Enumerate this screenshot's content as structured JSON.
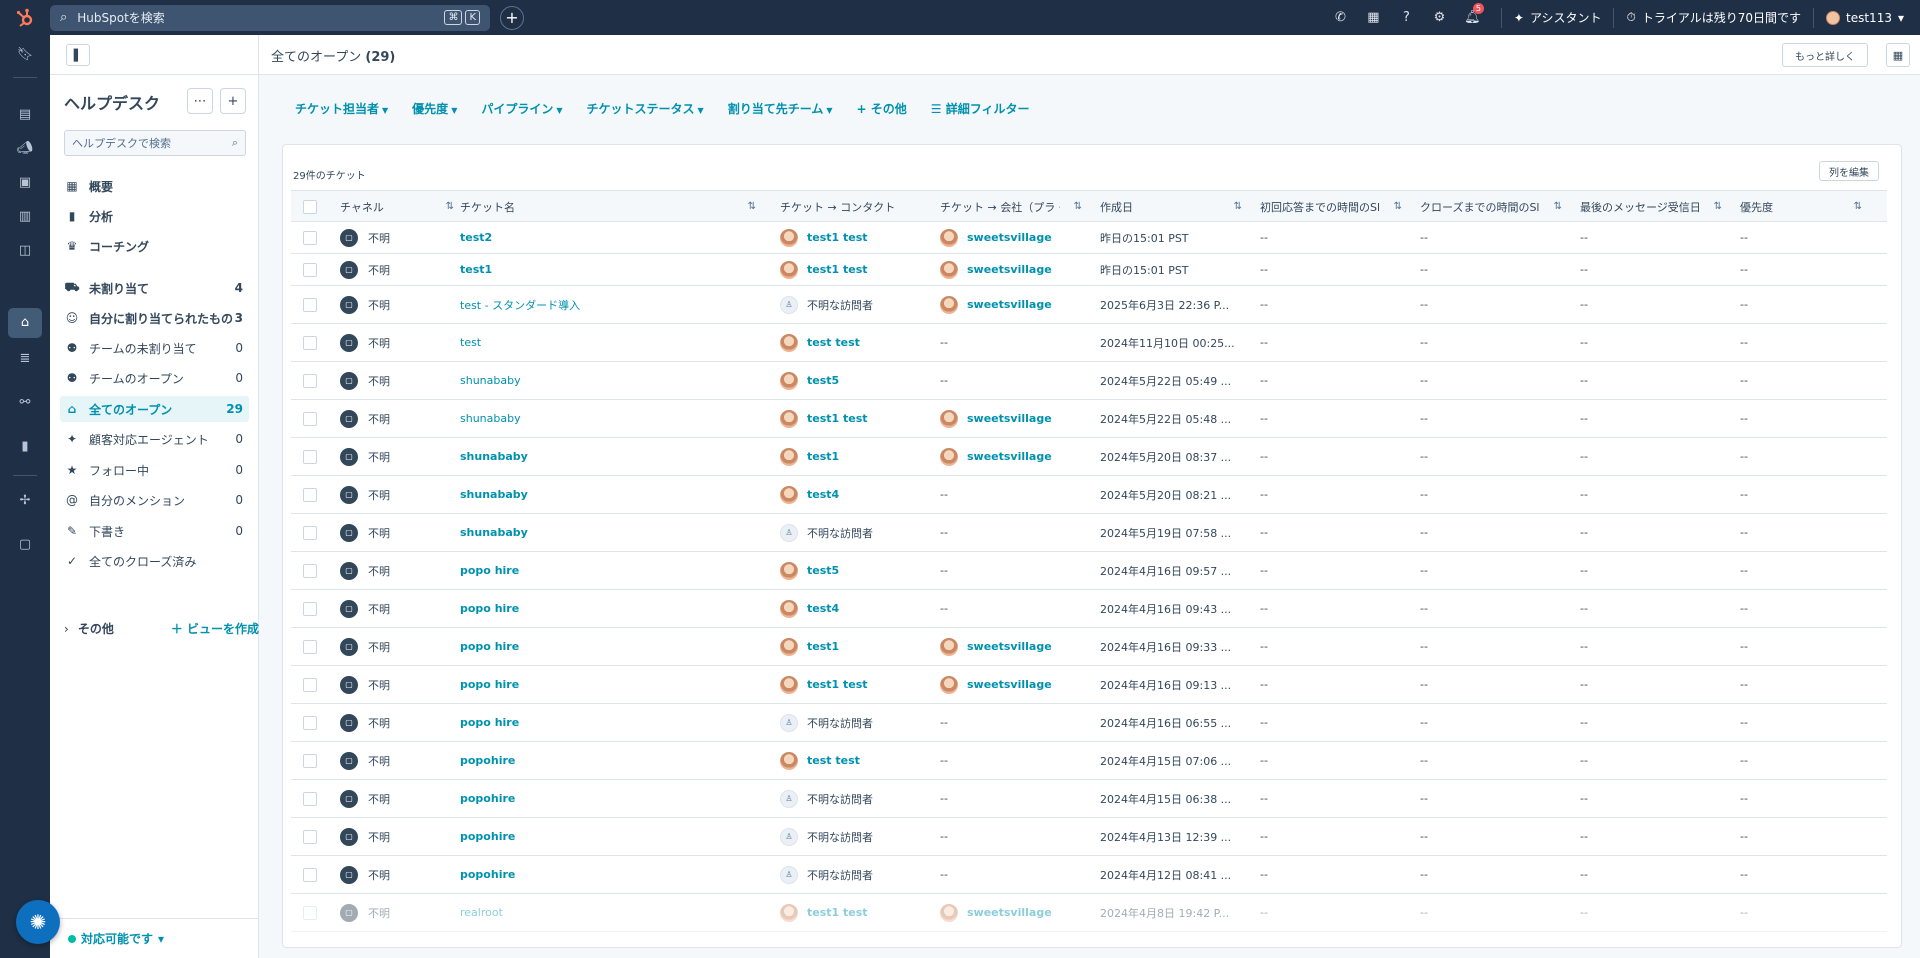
{
  "topbar": {
    "search_placeholder": "HubSpotを検索",
    "search_kbd": [
      "⌘",
      "K"
    ],
    "notification_count": "5",
    "assistant_label": "アシスタント",
    "trial_label": "トライアルは残り70日間です",
    "account_name": "test113"
  },
  "sidebar": {
    "title": "ヘルプデスク",
    "search_placeholder": "ヘルプデスクで検索",
    "items": [
      {
        "label": "概要",
        "icon": "dashboard-icon",
        "count": ""
      },
      {
        "label": "分析",
        "icon": "bar-chart-icon",
        "count": ""
      },
      {
        "label": "コーチング",
        "icon": "trophy-icon",
        "count": ""
      },
      {
        "label": "未割り当て",
        "icon": "inbox-unassigned-icon",
        "count": "4"
      },
      {
        "label": "自分に割り当てられたもの",
        "icon": "user-avatar-icon",
        "count": "3"
      },
      {
        "label": "チームの未割り当て",
        "icon": "team-icon",
        "count": "0"
      },
      {
        "label": "チームのオープン",
        "icon": "team-icon",
        "count": "0"
      },
      {
        "label": "全てのオープン",
        "icon": "inbox-icon",
        "count": "29"
      },
      {
        "label": "顧客対応エージェント",
        "icon": "sparkle-icon",
        "count": "0"
      },
      {
        "label": "フォロー中",
        "icon": "star-icon",
        "count": "0"
      },
      {
        "label": "自分のメンション",
        "icon": "at-icon",
        "count": "0"
      },
      {
        "label": "下書き",
        "icon": "pencil-icon",
        "count": "0"
      },
      {
        "label": "全てのクローズ済み",
        "icon": "check-icon",
        "count": ""
      }
    ],
    "more_label": "その他",
    "create_view_label": "＋ ビューを作成",
    "status_label": "対応可能です"
  },
  "main": {
    "title": "全てのオープン",
    "title_count": "(29)",
    "learn_more": "もっと詳しく",
    "filters": [
      "チケット担当者",
      "優先度",
      "パイプライン",
      "チケットステータス",
      "割り当て先チーム"
    ],
    "other_filter": "その他",
    "advanced_filter": "詳細フィルター",
    "ticket_count": "29件のチケット",
    "edit_columns": "列を編集"
  },
  "table": {
    "columns": [
      "チャネル",
      "チケット名",
      "チケット → コンタクト",
      "チケット → 会社（プラ・",
      "作成日",
      "初回応答までの時間のSl",
      "クローズまでの時間のSl",
      "最後のメッセージ受信日",
      "優先度"
    ],
    "rows": [
      {
        "channel": "不明",
        "name": "test2",
        "name_bold": true,
        "contact": "test1 test",
        "contact_type": "photo",
        "company": "sweetsvillage",
        "created": "昨日の15:01 PST",
        "sla1": "--",
        "sla2": "--",
        "last_msg": "--",
        "priority": "--"
      },
      {
        "channel": "不明",
        "name": "test1",
        "name_bold": true,
        "contact": "test1 test",
        "contact_type": "photo",
        "company": "sweetsvillage",
        "created": "昨日の15:01 PST",
        "sla1": "--",
        "sla2": "--",
        "last_msg": "--",
        "priority": "--"
      },
      {
        "channel": "不明",
        "name": "test - スタンダード導入",
        "name_bold": false,
        "contact": "不明な訪問者",
        "contact_type": "anon",
        "company": "sweetsvillage",
        "created": "2025年6月3日 22:36 P...",
        "sla1": "--",
        "sla2": "--",
        "last_msg": "--",
        "priority": "--"
      },
      {
        "channel": "不明",
        "name": "test",
        "name_bold": false,
        "contact": "test test",
        "contact_type": "photo",
        "company": "--",
        "created": "2024年11月10日 00:25...",
        "sla1": "--",
        "sla2": "--",
        "last_msg": "--",
        "priority": "--"
      },
      {
        "channel": "不明",
        "name": "shunababy",
        "name_bold": false,
        "contact": "test5",
        "contact_type": "photo",
        "company": "--",
        "created": "2024年5月22日 05:49 ...",
        "sla1": "--",
        "sla2": "--",
        "last_msg": "--",
        "priority": "--"
      },
      {
        "channel": "不明",
        "name": "shunababy",
        "name_bold": false,
        "contact": "test1 test",
        "contact_type": "photo",
        "company": "sweetsvillage",
        "created": "2024年5月22日 05:48 ...",
        "sla1": "--",
        "sla2": "--",
        "last_msg": "--",
        "priority": "--"
      },
      {
        "channel": "不明",
        "name": "shunababy",
        "name_bold": true,
        "contact": "test1",
        "contact_type": "photo",
        "company": "sweetsvillage",
        "created": "2024年5月20日 08:37 ...",
        "sla1": "--",
        "sla2": "--",
        "last_msg": "--",
        "priority": "--"
      },
      {
        "channel": "不明",
        "name": "shunababy",
        "name_bold": true,
        "contact": "test4",
        "contact_type": "photo",
        "company": "--",
        "created": "2024年5月20日 08:21 ...",
        "sla1": "--",
        "sla2": "--",
        "last_msg": "--",
        "priority": "--"
      },
      {
        "channel": "不明",
        "name": "shunababy",
        "name_bold": true,
        "contact": "不明な訪問者",
        "contact_type": "anon",
        "company": "--",
        "created": "2024年5月19日 07:58 ...",
        "sla1": "--",
        "sla2": "--",
        "last_msg": "--",
        "priority": "--"
      },
      {
        "channel": "不明",
        "name": "popo hire",
        "name_bold": true,
        "contact": "test5",
        "contact_type": "photo",
        "company": "--",
        "created": "2024年4月16日 09:57 ...",
        "sla1": "--",
        "sla2": "--",
        "last_msg": "--",
        "priority": "--"
      },
      {
        "channel": "不明",
        "name": "popo hire",
        "name_bold": true,
        "contact": "test4",
        "contact_type": "photo",
        "company": "--",
        "created": "2024年4月16日 09:43 ...",
        "sla1": "--",
        "sla2": "--",
        "last_msg": "--",
        "priority": "--"
      },
      {
        "channel": "不明",
        "name": "popo hire",
        "name_bold": true,
        "contact": "test1",
        "contact_type": "photo",
        "company": "sweetsvillage",
        "created": "2024年4月16日 09:33 ...",
        "sla1": "--",
        "sla2": "--",
        "last_msg": "--",
        "priority": "--"
      },
      {
        "channel": "不明",
        "name": "popo hire",
        "name_bold": true,
        "contact": "test1 test",
        "contact_type": "photo",
        "company": "sweetsvillage",
        "created": "2024年4月16日 09:13 ...",
        "sla1": "--",
        "sla2": "--",
        "last_msg": "--",
        "priority": "--"
      },
      {
        "channel": "不明",
        "name": "popo hire",
        "name_bold": true,
        "contact": "不明な訪問者",
        "contact_type": "anon",
        "company": "--",
        "created": "2024年4月16日 06:55 ...",
        "sla1": "--",
        "sla2": "--",
        "last_msg": "--",
        "priority": "--"
      },
      {
        "channel": "不明",
        "name": "popohire",
        "name_bold": true,
        "contact": "test test",
        "contact_type": "photo",
        "company": "--",
        "created": "2024年4月15日 07:06 ...",
        "sla1": "--",
        "sla2": "--",
        "last_msg": "--",
        "priority": "--"
      },
      {
        "channel": "不明",
        "name": "popohire",
        "name_bold": true,
        "contact": "不明な訪問者",
        "contact_type": "anon",
        "company": "--",
        "created": "2024年4月15日 06:38 ...",
        "sla1": "--",
        "sla2": "--",
        "last_msg": "--",
        "priority": "--"
      },
      {
        "channel": "不明",
        "name": "popohire",
        "name_bold": true,
        "contact": "不明な訪問者",
        "contact_type": "anon",
        "company": "--",
        "created": "2024年4月13日 12:39 ...",
        "sla1": "--",
        "sla2": "--",
        "last_msg": "--",
        "priority": "--"
      },
      {
        "channel": "不明",
        "name": "popohire",
        "name_bold": true,
        "contact": "不明な訪問者",
        "contact_type": "anon",
        "company": "--",
        "created": "2024年4月12日 08:41 ...",
        "sla1": "--",
        "sla2": "--",
        "last_msg": "--",
        "priority": "--"
      },
      {
        "channel": "不明",
        "name": "realroot",
        "name_bold": false,
        "contact": "test1 test",
        "contact_type": "photo",
        "company": "sweetsvillage",
        "created": "2024年4月8日 19:42 P...",
        "sla1": "--",
        "sla2": "--",
        "last_msg": "--",
        "priority": "--"
      }
    ]
  },
  "colors": {
    "nav_dark": "#1f2f46",
    "accent": "#0091ae",
    "active_bg": "#e5f5f8",
    "brand_orange": "#ff7a59",
    "status_green": "#00bda5"
  }
}
